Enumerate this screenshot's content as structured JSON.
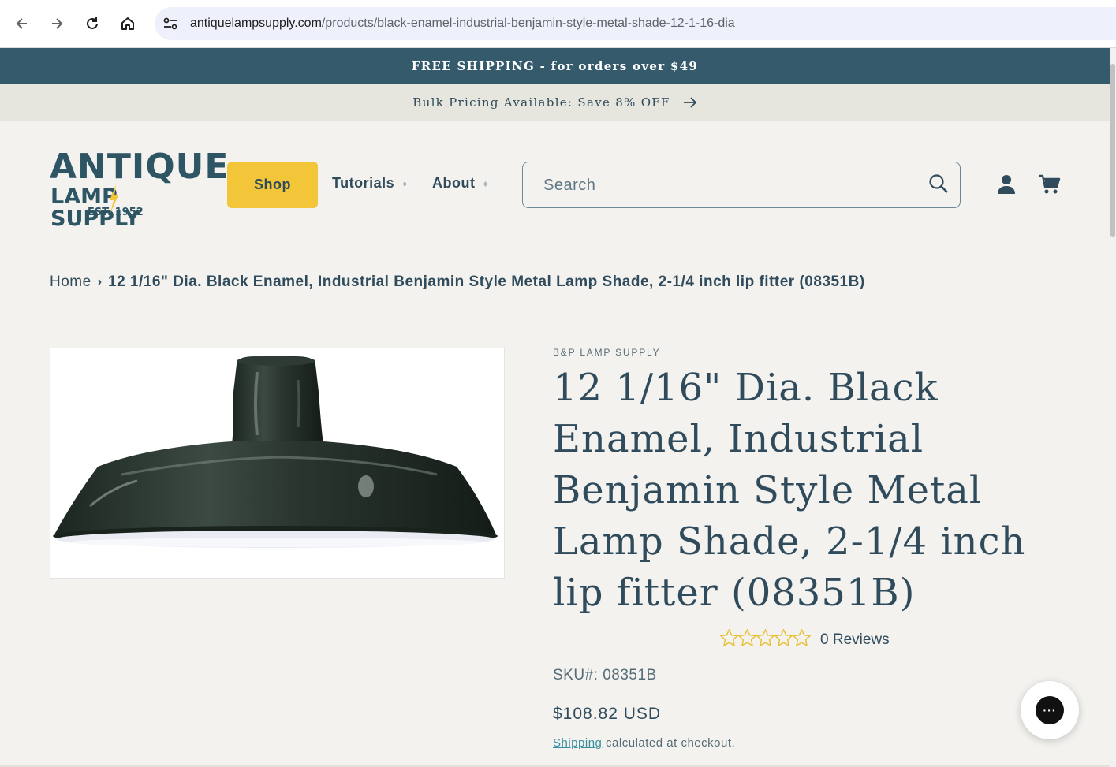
{
  "browser": {
    "url_domain": "antiquelampsupply.com",
    "url_path": "/products/black-enamel-industrial-benjamin-style-metal-shade-12-1-16-dia"
  },
  "announcements": {
    "shipping": "FREE SHIPPING - for orders over $49",
    "bulk": "Bulk Pricing Available: Save 8% OFF"
  },
  "logo": {
    "line1": "ANTIQUE",
    "line2": "LAMP SUPPLY",
    "line3": "EST. 1952"
  },
  "nav": {
    "shop": "Shop",
    "tutorials": "Tutorials",
    "about": "About"
  },
  "search": {
    "placeholder": "Search"
  },
  "breadcrumb": {
    "home": "Home",
    "current": "12 1/16\" Dia. Black Enamel, Industrial Benjamin Style Metal Lamp Shade, 2-1/4 inch lip fitter (08351B)"
  },
  "product": {
    "vendor": "B&P LAMP SUPPLY",
    "title": "12 1/16\" Dia. Black Enamel, Industrial Benjamin Style Metal Lamp Shade, 2-1/4 inch lip fitter (08351B)",
    "rating": 0,
    "rating_max": 5,
    "reviews": "0 Reviews",
    "sku": "SKU#: 08351B",
    "price": "$108.82 USD",
    "shipping_link": "Shipping",
    "shipping_note": " calculated at checkout."
  },
  "colors": {
    "primary": "#2f4b5c",
    "announcement_bg": "#345a6c",
    "shop_button": "#f2c638",
    "star": "#e8c033"
  }
}
